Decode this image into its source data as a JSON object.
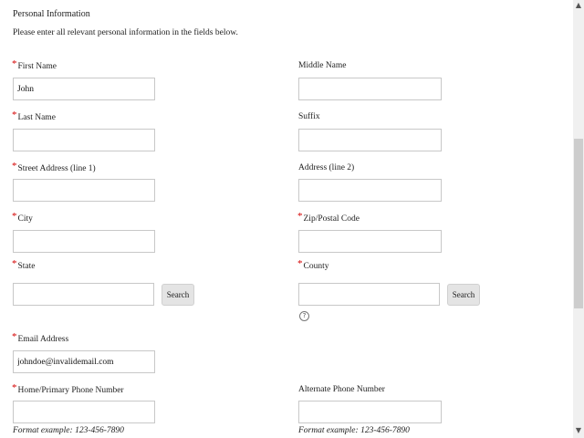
{
  "section": {
    "title": "Personal Information",
    "intro": "Please enter all relevant personal information in the fields below."
  },
  "required_marker": "*",
  "fields": {
    "first_name": {
      "label": "First Name",
      "value": "John"
    },
    "middle_name": {
      "label": "Middle Name",
      "value": ""
    },
    "last_name": {
      "label": "Last Name",
      "value": ""
    },
    "suffix": {
      "label": "Suffix",
      "value": ""
    },
    "street1": {
      "label": "Street Address (line 1)",
      "value": ""
    },
    "street2": {
      "label": "Address (line 2)",
      "value": ""
    },
    "city": {
      "label": "City",
      "value": ""
    },
    "zip": {
      "label": "Zip/Postal Code",
      "value": ""
    },
    "state": {
      "label": "State",
      "value": ""
    },
    "county": {
      "label": "County",
      "value": ""
    },
    "email": {
      "label": "Email Address",
      "value": "johndoe@invalidemail.com"
    },
    "home_phone": {
      "label": "Home/Primary Phone Number",
      "value": ""
    },
    "alt_phone": {
      "label": "Alternate Phone Number",
      "value": ""
    }
  },
  "buttons": {
    "search_label": "Search"
  },
  "help": {
    "glyph": "?"
  },
  "format_hint": "Format example:  123-456-7890",
  "icons": {
    "scroll_up": "▲",
    "scroll_down": "▼"
  }
}
